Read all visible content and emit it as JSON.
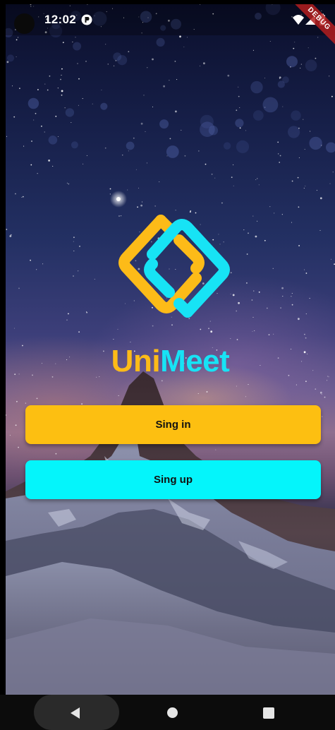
{
  "status_bar": {
    "time": "12:02",
    "notification_icon": "circle-notification-icon",
    "wifi_icon": "wifi-icon",
    "signal_icon": "cell-signal-icon",
    "battery_icon": "battery-icon"
  },
  "debug_banner": {
    "label": "DEBUG"
  },
  "logo": {
    "icon": "interlocked-diamonds-logo",
    "left_color": "#fdbb18",
    "right_color": "#17e3f5"
  },
  "title": {
    "part1": "Uni",
    "part2": "Meet",
    "color_part1": "#fdbb18",
    "color_part2": "#17e3f5"
  },
  "buttons": {
    "signin_label": "Sing in",
    "signup_label": "Sing up",
    "signin_color": "#fdbf11",
    "signup_color": "#04f5fb"
  },
  "nav_bar": {
    "back_icon": "back-triangle-icon",
    "home_icon": "home-circle-icon",
    "recents_icon": "recents-square-icon"
  }
}
